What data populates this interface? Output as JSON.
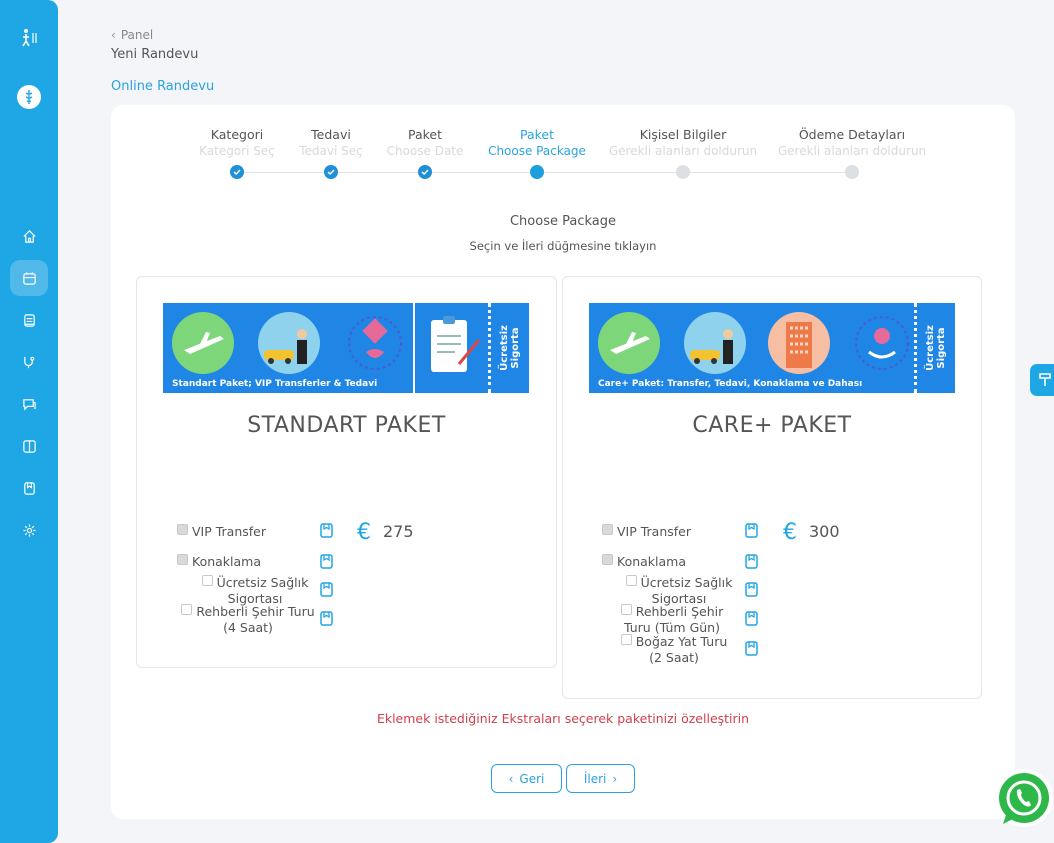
{
  "sidebar": {
    "logo": "🩺",
    "items": [
      {
        "icon": "home-icon"
      },
      {
        "icon": "calendar-icon",
        "active": true
      },
      {
        "icon": "document-icon"
      },
      {
        "icon": "stethoscope-icon"
      },
      {
        "icon": "chat-icon"
      },
      {
        "icon": "book-icon"
      },
      {
        "icon": "bookmark-icon"
      },
      {
        "icon": "gear-icon"
      }
    ]
  },
  "header": {
    "breadcrumb": "Panel",
    "title": "Yeni Randevu",
    "section": "Online Randevu"
  },
  "stepper": {
    "steps": [
      {
        "label": "Kategori",
        "sub": "Kategori Seç",
        "state": "done"
      },
      {
        "label": "Tedavi",
        "sub": "Tedavi Seç",
        "state": "done"
      },
      {
        "label": "Paket",
        "sub": "Choose Date",
        "state": "done"
      },
      {
        "label": "Paket",
        "sub": "Choose Package",
        "state": "current"
      },
      {
        "label": "Kişisel Bilgiler",
        "sub": "Gerekli alanları doldurun",
        "state": "todo"
      },
      {
        "label": "Ödeme Detayları",
        "sub": "Gerekli alanları doldurun",
        "state": "todo"
      }
    ]
  },
  "content": {
    "title": "Choose Package",
    "subtitle": "Seçin ve İleri düğmesine tıklayın",
    "extras_note": "Eklemek istediğiniz Ekstraları seçerek paketinizi özelleştirin"
  },
  "packages": [
    {
      "banner_caption": "Standart Paket; VIP Transferler & Tedavi",
      "banner_tag": "Ücretsiz\nSigorta",
      "name": "STANDART PAKET",
      "currency": "€",
      "price": "275",
      "options": [
        {
          "label": "VIP Transfer",
          "checked": true
        },
        {
          "label": "Konaklama",
          "checked": true
        },
        {
          "label": "Ücretsiz Sağlık Sigortası",
          "checked": false
        },
        {
          "label": "Rehberli Şehir Turu (4 Saat)",
          "checked": false
        }
      ]
    },
    {
      "banner_caption": "Care+ Paket: Transfer, Tedavi, Konaklama ve Dahası",
      "banner_tag": "Ücretsiz\nSigorta",
      "name": "CARE+ PAKET",
      "currency": "€",
      "price": "300",
      "options": [
        {
          "label": "VIP Transfer",
          "checked": true
        },
        {
          "label": "Konaklama",
          "checked": true
        },
        {
          "label": "Ücretsiz Sağlık Sigortası",
          "checked": false
        },
        {
          "label": "Rehberli Şehir Turu (Tüm Gün)",
          "checked": false
        },
        {
          "label": "Boğaz Yat Turu (2 Saat)",
          "checked": false
        }
      ]
    }
  ],
  "buttons": {
    "back": "Geri",
    "next": "İleri"
  },
  "colors": {
    "accent": "#1fa6e5",
    "warning": "#d0404c"
  }
}
